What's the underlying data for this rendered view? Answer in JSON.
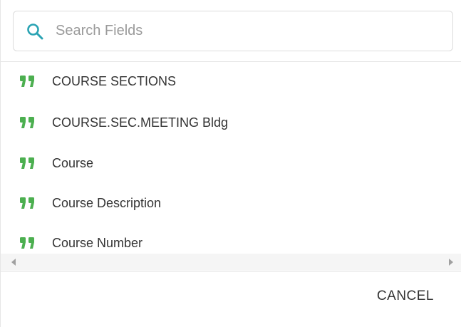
{
  "search": {
    "placeholder": "Search Fields",
    "value": ""
  },
  "fields": [
    {
      "label": "COURSE SECTIONS"
    },
    {
      "label": "COURSE.SEC.MEETING Bldg"
    },
    {
      "label": "Course"
    },
    {
      "label": "Course Description"
    },
    {
      "label": "Course Number"
    }
  ],
  "footer": {
    "cancel_label": "CANCEL"
  },
  "colors": {
    "accent": "#2aa3b3",
    "quote_icon": "#4caf50",
    "text": "#333333"
  },
  "icons": {
    "search": "search-icon",
    "field_type": "quote-icon"
  }
}
